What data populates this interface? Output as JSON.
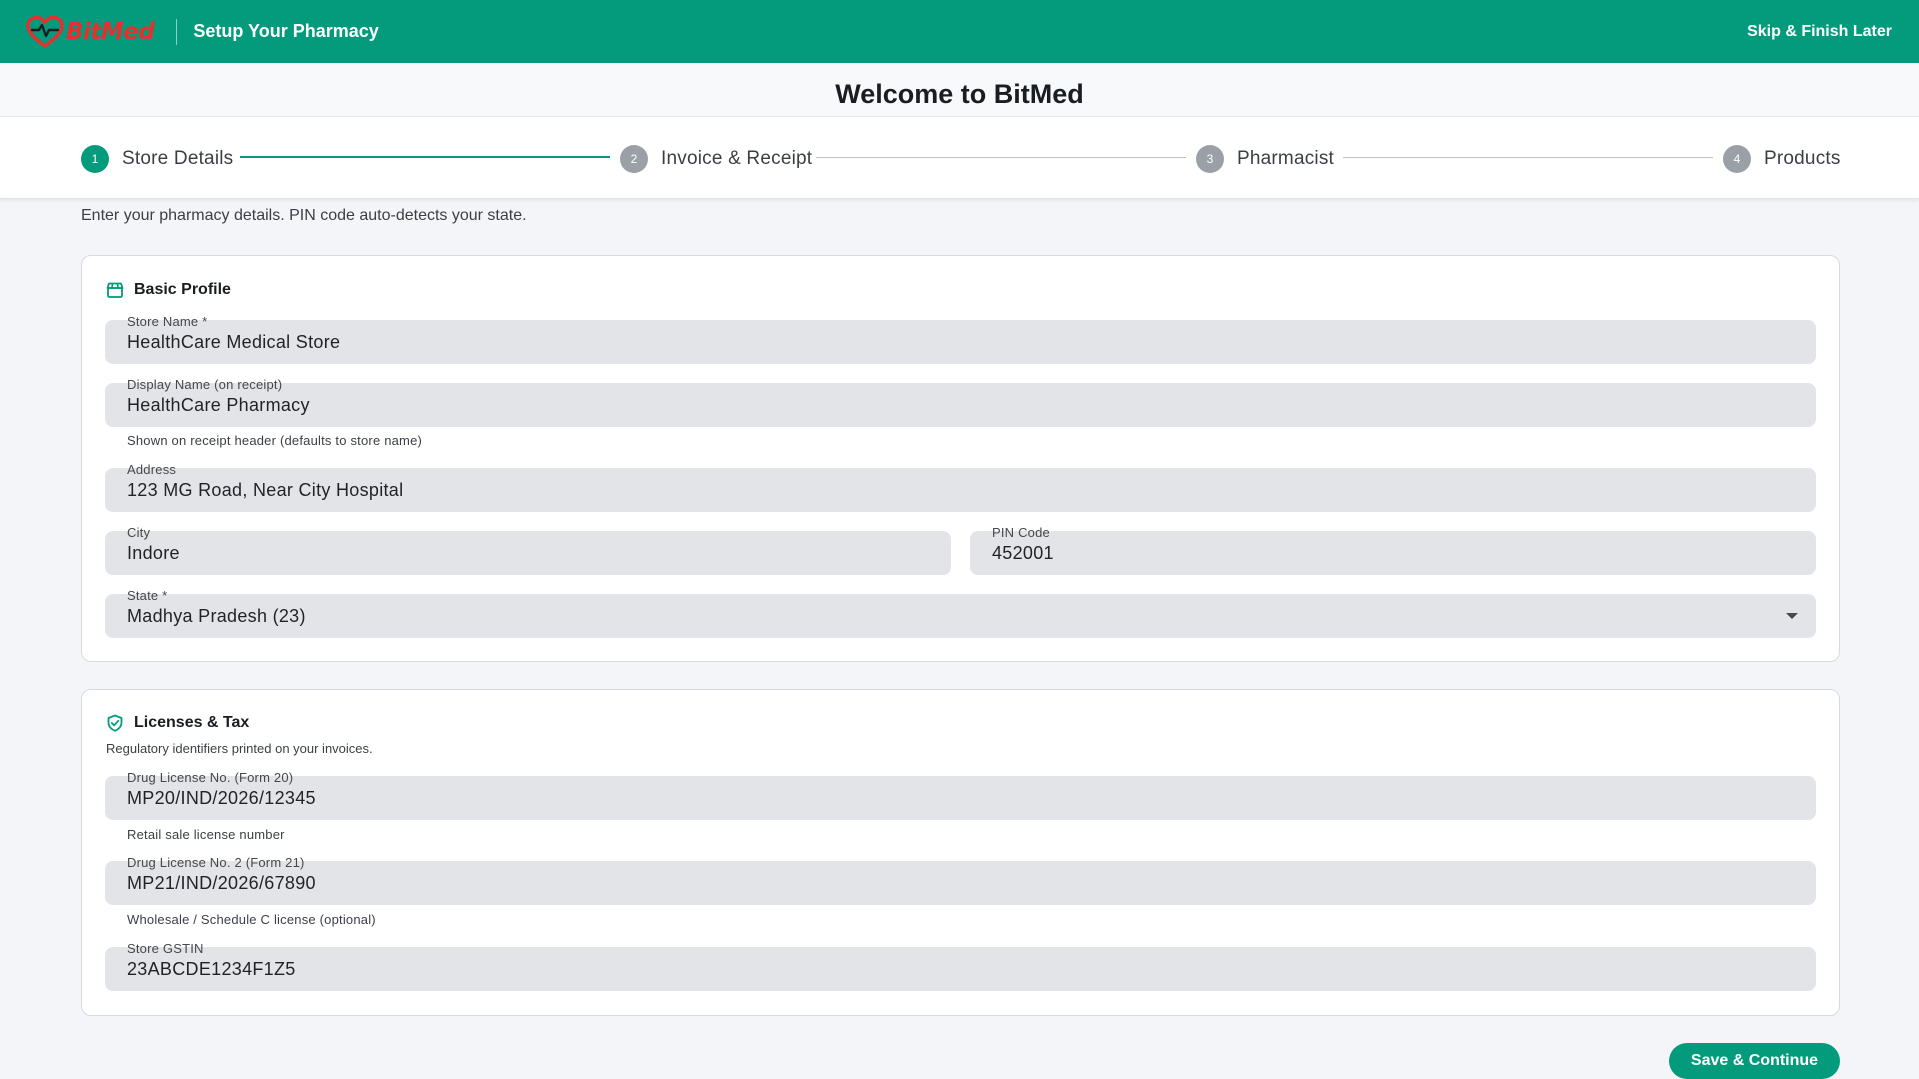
{
  "app": {
    "brand": "BitMed",
    "header_title": "Setup Your Pharmacy",
    "skip_label": "Skip & Finish Later",
    "welcome": "Welcome to BitMed",
    "colors": {
      "primary": "#049b7c",
      "logo_red": "#e2322f",
      "field_bg": "#e3e4e8"
    }
  },
  "stepper": {
    "steps": [
      {
        "number": "1",
        "label": "Store Details",
        "state": "active"
      },
      {
        "number": "2",
        "label": "Invoice & Receipt",
        "state": "pending"
      },
      {
        "number": "3",
        "label": "Pharmacist",
        "state": "pending"
      },
      {
        "number": "4",
        "label": "Products",
        "state": "pending"
      }
    ]
  },
  "intro": "Enter your pharmacy details. PIN code auto-detects your state.",
  "basic_profile": {
    "title": "Basic Profile",
    "icon": "store-icon",
    "store_name": {
      "label": "Store Name *",
      "value": "HealthCare Medical Store"
    },
    "display_name": {
      "label": "Display Name (on receipt)",
      "value": "HealthCare Pharmacy",
      "hint": "Shown on receipt header (defaults to store name)"
    },
    "address": {
      "label": "Address",
      "value": "123 MG Road, Near City Hospital"
    },
    "city": {
      "label": "City",
      "value": "Indore"
    },
    "pin_code": {
      "label": "PIN Code",
      "value": "452001"
    },
    "state": {
      "label": "State *",
      "value": "Madhya Pradesh (23)"
    }
  },
  "licenses": {
    "title": "Licenses & Tax",
    "icon": "shield-check-icon",
    "subtitle": "Regulatory identifiers printed on your invoices.",
    "drug_license_1": {
      "label": "Drug License No. (Form 20)",
      "value": "MP20/IND/2026/12345",
      "hint": "Retail sale license number"
    },
    "drug_license_2": {
      "label": "Drug License No. 2 (Form 21)",
      "value": "MP21/IND/2026/67890",
      "hint": "Wholesale / Schedule C license (optional)"
    },
    "gstin": {
      "label": "Store GSTIN",
      "value": "23ABCDE1234F1Z5"
    }
  },
  "actions": {
    "save_label": "Save & Continue"
  }
}
